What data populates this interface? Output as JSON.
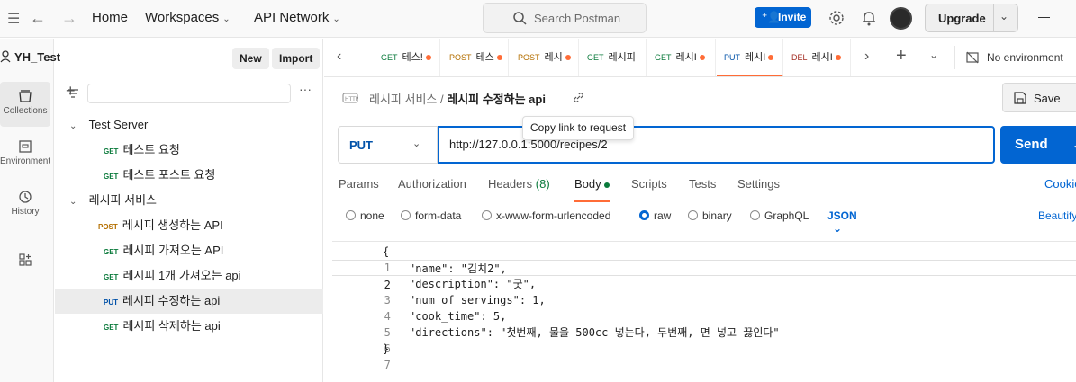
{
  "topbar": {
    "home": "Home",
    "workspaces": "Workspaces",
    "api_network": "API Network",
    "search_placeholder": "Search Postman",
    "invite": "Invite",
    "upgrade": "Upgrade"
  },
  "rail": {
    "items": [
      {
        "label": "Collections",
        "icon": "collections-icon"
      },
      {
        "label": "Environments",
        "icon": "environments-icon"
      },
      {
        "label": "History",
        "icon": "history-icon"
      },
      {
        "label": "",
        "icon": "apps-icon"
      }
    ]
  },
  "sidebar": {
    "workspace": "YH_Test",
    "new_label": "New",
    "import_label": "Import",
    "collections": [
      {
        "name": "Test Server",
        "requests": [
          {
            "method": "GET",
            "name": "테스트 요청"
          },
          {
            "method": "GET",
            "name": "테스트 포스트 요청"
          }
        ]
      },
      {
        "name": "레시피 서비스",
        "requests": [
          {
            "method": "POST",
            "name": "레시피 생성하는 API"
          },
          {
            "method": "GET",
            "name": "레시피 가져오는 API"
          },
          {
            "method": "GET",
            "name": "레시피 1개 가져오는 api"
          },
          {
            "method": "PUT",
            "name": "레시피 수정하는 api"
          },
          {
            "method": "GET",
            "name": "레시피 삭제하는 api"
          }
        ]
      }
    ]
  },
  "tabs": [
    {
      "method": "GET",
      "name": "테스!"
    },
    {
      "method": "POST",
      "name": "테스"
    },
    {
      "method": "POST",
      "name": "레시"
    },
    {
      "method": "GET",
      "name": "레시피"
    },
    {
      "method": "GET",
      "name": "레시I"
    },
    {
      "method": "PUT",
      "name": "레시I"
    },
    {
      "method": "DEL",
      "name": "레시I"
    }
  ],
  "environment": "No environment",
  "request": {
    "breadcrumb_parent": "레시피 서비스",
    "breadcrumb_current": "레시피 수정하는 api",
    "tooltip": "Copy link to request",
    "save": "Save",
    "method": "PUT",
    "url": "http://127.0.0.1:5000/recipes/2",
    "send": "Send",
    "tabs": {
      "params": "Params",
      "authorization": "Authorization",
      "headers": "Headers",
      "headers_count": "(8)",
      "body": "Body",
      "scripts": "Scripts",
      "tests": "Tests",
      "settings": "Settings"
    },
    "cookies": "Cookies",
    "body_types": [
      "none",
      "form-data",
      "x-www-form-urlencoded",
      "raw",
      "binary",
      "GraphQL"
    ],
    "body_format": "JSON",
    "beautify": "Beautify",
    "code_lines": [
      {
        "n": "1",
        "text": "{"
      },
      {
        "n": "2",
        "text": "\"name\": \"김치2\","
      },
      {
        "n": "3",
        "text": "\"description\": \"굿\","
      },
      {
        "n": "4",
        "text": "\"num_of_servings\": 1,"
      },
      {
        "n": "5",
        "text": "\"cook_time\": 5,"
      },
      {
        "n": "6",
        "text": "\"directions\": \"첫번째, 물을 500cc 넣는다, 두번째, 면 넣고 끓인다\""
      },
      {
        "n": "7",
        "text": "}"
      }
    ]
  }
}
